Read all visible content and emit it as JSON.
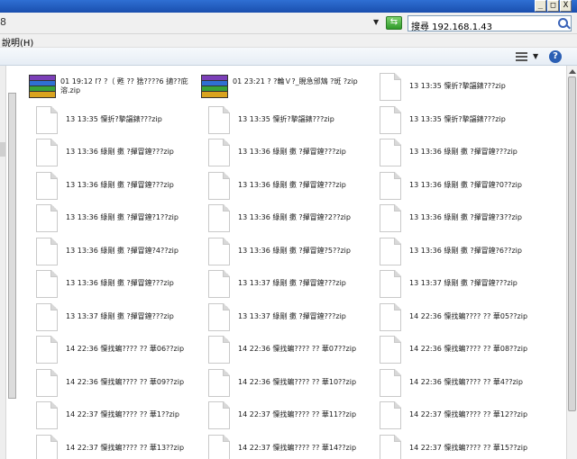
{
  "toolbar": {
    "address_fragment": "8",
    "search_value": "搜尋 192.168.1.43",
    "help_menu": "說明(H)"
  },
  "window": {
    "min": "_",
    "max": "□",
    "close": "X"
  },
  "files": [
    {
      "name": "01 19:12 ľ?    ?（ 甦   ??   猞????6 擿??庇溶.zip",
      "type": "rar"
    },
    {
      "name": "01 23:21 ?    ?輪Ｖ?_睍急邠鴆  ?斑 ?zip",
      "type": "rar"
    },
    {
      "name": "13 13:35 懍折?摯諨錶???zip",
      "type": "doc"
    },
    {
      "name": "13 13:35 懍折?摯諨錶???zip",
      "type": "doc"
    },
    {
      "name": "13 13:35 懍折?摯諨錶???zip",
      "type": "doc"
    },
    {
      "name": "13 13:35 懍折?摯諨錶???zip",
      "type": "doc"
    },
    {
      "name": "13 13:36 綠剛   擻    ?撣冒鍷???zip",
      "type": "doc"
    },
    {
      "name": "13 13:36 綠剛   擻    ?撣冒鍷???zip",
      "type": "doc"
    },
    {
      "name": "13 13:36 綠剛   擻    ?撣冒鍷???zip",
      "type": "doc"
    },
    {
      "name": "13 13:36 綠剛   擻    ?撣冒鍷???zip",
      "type": "doc"
    },
    {
      "name": "13 13:36 綠剛   擻    ?撣冒鍷???zip",
      "type": "doc"
    },
    {
      "name": "13 13:36 綠剛   擻    ?撣冒鍷?0??zip",
      "type": "doc"
    },
    {
      "name": "13 13:36 綠剛   擻    ?撣冒鍷?1??zip",
      "type": "doc"
    },
    {
      "name": "13 13:36 綠剛   擻    ?撣冒鍷?2??zip",
      "type": "doc"
    },
    {
      "name": "13 13:36 綠剛   擻    ?撣冒鍷?3??zip",
      "type": "doc"
    },
    {
      "name": "13 13:36 綠剛   擻    ?撣冒鍷?4??zip",
      "type": "doc"
    },
    {
      "name": "13 13:36 綠剛   擻    ?撣冒鍷?5??zip",
      "type": "doc"
    },
    {
      "name": "13 13:36 綠剛   擻    ?撣冒鍷?6??zip",
      "type": "doc"
    },
    {
      "name": "13 13:36 綠剛   擻    ?撣冒鍷???zip",
      "type": "doc"
    },
    {
      "name": "13 13:37 綠剛   擻    ?撣冒鍷???zip",
      "type": "doc"
    },
    {
      "name": "13 13:37 綠剛   擻    ?撣冒鍷???zip",
      "type": "doc"
    },
    {
      "name": "13 13:37 綠剛   擻    ?撣冒鍷???zip",
      "type": "doc"
    },
    {
      "name": "13 13:37 綠剛   擻    ?撣冒鍷???zip",
      "type": "doc"
    },
    {
      "name": "14 22:36 懍找蝙????    ??    華05??zip",
      "type": "doc"
    },
    {
      "name": "14 22:36 懍找蝙????    ??    華06??zip",
      "type": "doc"
    },
    {
      "name": "14 22:36 懍找蝙????    ??    華07??zip",
      "type": "doc"
    },
    {
      "name": "14 22:36 懍找蝙????    ??    華08??zip",
      "type": "doc"
    },
    {
      "name": "14 22:36 懍找蝙????    ??    華09??zip",
      "type": "doc"
    },
    {
      "name": "14 22:36 懍找蝙????    ??    華10??zip",
      "type": "doc"
    },
    {
      "name": "14 22:36 懍找蝙????    ??    華4??zip",
      "type": "doc"
    },
    {
      "name": "14 22:37 懍找蝙????    ??    華1??zip",
      "type": "doc"
    },
    {
      "name": "14 22:37 懍找蝙????    ??    華11??zip",
      "type": "doc"
    },
    {
      "name": "14 22:37 懍找蝙????    ??    華12??zip",
      "type": "doc"
    },
    {
      "name": "14 22:37 懍找蝙????    ??    華13??zip",
      "type": "doc"
    },
    {
      "name": "14 22:37 懍找蝙????    ??    華14??zip",
      "type": "doc"
    },
    {
      "name": "14 22:37 懍找蝙????    ??    華15??zip",
      "type": "doc"
    }
  ]
}
